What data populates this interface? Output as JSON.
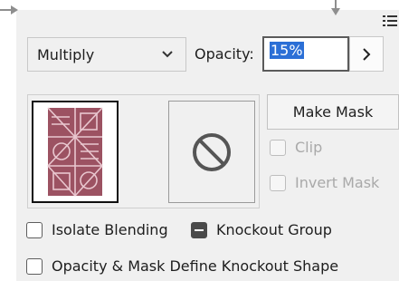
{
  "blend_mode": {
    "value": "Multiply"
  },
  "opacity": {
    "label": "Opacity:",
    "value": "15%"
  },
  "mask": {
    "make_mask_label": "Make Mask"
  },
  "options": {
    "clip": {
      "label": "Clip",
      "checked": false,
      "disabled": true
    },
    "invert_mask": {
      "label": "Invert Mask",
      "checked": false,
      "disabled": true
    },
    "isolate_blending": {
      "label": "Isolate Blending",
      "checked": false
    },
    "knockout_group": {
      "label": "Knockout Group",
      "state": "mixed"
    },
    "opacity_mask_knockout": {
      "label": "Opacity & Mask Define Knockout Shape",
      "checked": false
    }
  },
  "icons": {
    "left_arrow": "arrow-right-icon",
    "top_arrow": "arrow-down-icon",
    "menu": "panel-menu-icon",
    "no_mask": "prohibited-icon"
  },
  "colors": {
    "selection": "#2b6fd6",
    "artwork": "#9c5262",
    "panel_bg": "#f0f0f0"
  }
}
